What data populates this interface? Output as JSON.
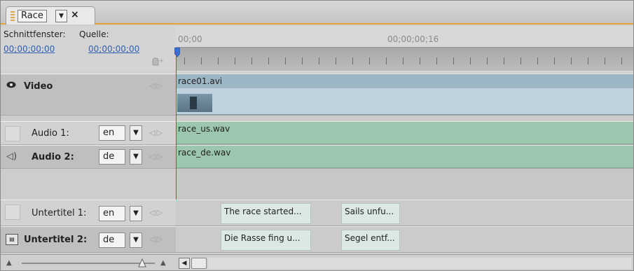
{
  "tab": {
    "title": "Race",
    "menu_icon": "dropdown-icon",
    "close_label": "×"
  },
  "header": {
    "timeline_label": "Schnittfenster:",
    "source_label": "Quelle:",
    "timeline_timecode": "00;00;00;00",
    "source_timecode": "00;00;00;00"
  },
  "ruler": {
    "start_timecode": "00;00",
    "mid_timecode": "00;00;00;16"
  },
  "tracks": {
    "video": {
      "name": "Video",
      "clip": "race01.avi"
    },
    "audio1": {
      "name": "Audio 1:",
      "lang": "en",
      "clip": "race_us.wav"
    },
    "audio2": {
      "name": "Audio 2:",
      "lang": "de",
      "clip": "race_de.wav"
    },
    "sub1": {
      "name": "Untertitel 1:",
      "lang": "en",
      "clips": [
        "The race started...",
        "Sails unfu..."
      ]
    },
    "sub2": {
      "name": "Untertitel 2:",
      "lang": "de",
      "clips": [
        "Die Rasse fing u...",
        "Segel entf..."
      ]
    }
  },
  "colors": {
    "accent_orange": "#e8a23a",
    "playhead_red": "#d23a3a",
    "video_clip": "#9db6c6",
    "audio_clip": "#9dc6ae",
    "subtitle_clip": "#dce8e6"
  }
}
